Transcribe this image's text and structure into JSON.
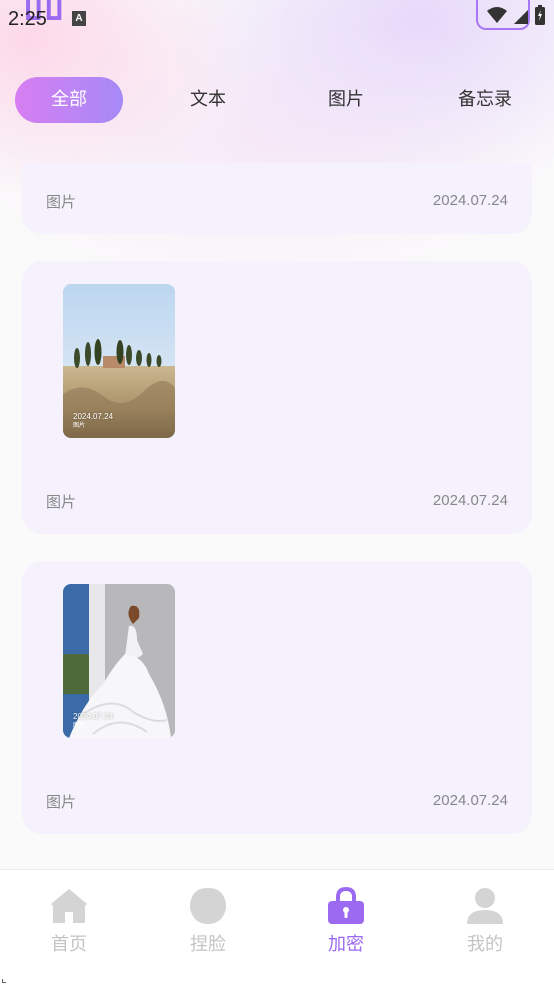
{
  "status_bar": {
    "time": "2:25",
    "a_badge": "A"
  },
  "tabs": [
    {
      "label": "全部",
      "active": true
    },
    {
      "label": "文本",
      "active": false
    },
    {
      "label": "图片",
      "active": false
    },
    {
      "label": "备忘录",
      "active": false
    }
  ],
  "items": [
    {
      "type": "图片",
      "date": "2024.07.24"
    },
    {
      "type": "图片",
      "date": "2024.07.24",
      "thumb_stamp": "2024.07.24",
      "thumb_sub": "图片"
    },
    {
      "type": "图片",
      "date": "2024.07.24",
      "thumb_stamp": "2024.07.24",
      "thumb_sub": "图片"
    }
  ],
  "nav": [
    {
      "label": "首页",
      "icon": "home-icon",
      "active": false
    },
    {
      "label": "捏脸",
      "icon": "face-icon",
      "active": false
    },
    {
      "label": "加密",
      "icon": "lock-icon",
      "active": true
    },
    {
      "label": "我的",
      "icon": "user-icon",
      "active": false
    }
  ],
  "colors": {
    "accent": "#9b6af1",
    "tab_gradient_start": "#d77ef2",
    "tab_gradient_end": "#a58af6",
    "card_bg": "#f5f2fd"
  }
}
